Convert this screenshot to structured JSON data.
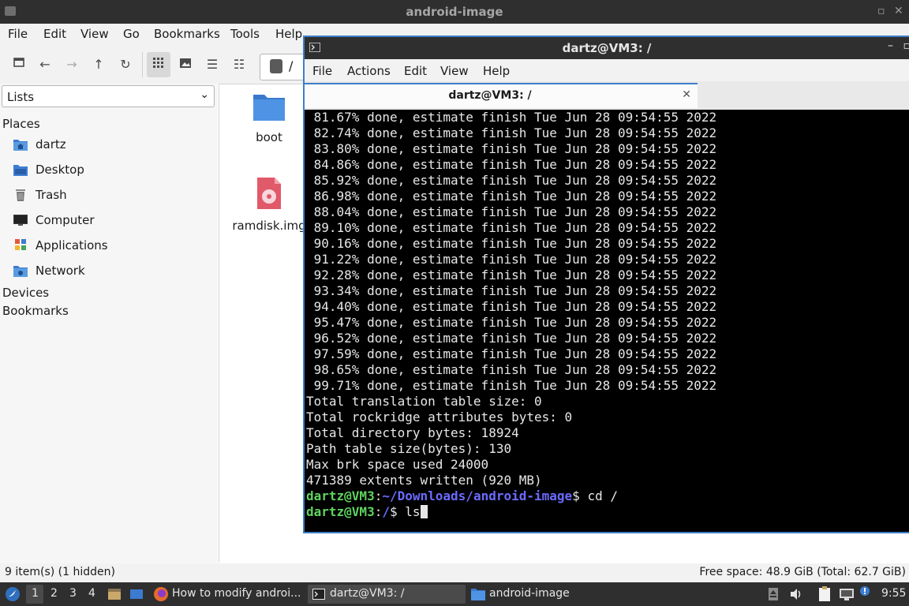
{
  "file_manager": {
    "title": "android-image",
    "menu": [
      "File",
      "Edit",
      "View",
      "Go",
      "Bookmarks",
      "Tools",
      "Help"
    ],
    "path_field": "/",
    "sidebar": {
      "selector": "Lists",
      "places_header": "Places",
      "places": [
        {
          "label": "dartz",
          "icon": "home-folder-icon"
        },
        {
          "label": "Desktop",
          "icon": "desktop-icon"
        },
        {
          "label": "Trash",
          "icon": "trash-icon"
        },
        {
          "label": "Computer",
          "icon": "computer-icon"
        },
        {
          "label": "Applications",
          "icon": "applications-icon"
        },
        {
          "label": "Network",
          "icon": "network-icon"
        }
      ],
      "devices_header": "Devices",
      "bookmarks_header": "Bookmarks"
    },
    "files": [
      {
        "name": "boot",
        "icon": "folder-icon"
      },
      {
        "name": "ramdisk.img",
        "icon": "disk-image-icon"
      }
    ],
    "status_left": "9 item(s) (1 hidden)",
    "status_right": "Free space: 48.9 GiB (Total: 62.7 GiB)"
  },
  "terminal": {
    "title": "dartz@VM3: /",
    "menu": [
      "File",
      "Actions",
      "Edit",
      "View",
      "Help"
    ],
    "tab_label": "dartz@VM3: /",
    "lines": [
      " 81.67% done, estimate finish Tue Jun 28 09:54:55 2022",
      " 82.74% done, estimate finish Tue Jun 28 09:54:55 2022",
      " 83.80% done, estimate finish Tue Jun 28 09:54:55 2022",
      " 84.86% done, estimate finish Tue Jun 28 09:54:55 2022",
      " 85.92% done, estimate finish Tue Jun 28 09:54:55 2022",
      " 86.98% done, estimate finish Tue Jun 28 09:54:55 2022",
      " 88.04% done, estimate finish Tue Jun 28 09:54:55 2022",
      " 89.10% done, estimate finish Tue Jun 28 09:54:55 2022",
      " 90.16% done, estimate finish Tue Jun 28 09:54:55 2022",
      " 91.22% done, estimate finish Tue Jun 28 09:54:55 2022",
      " 92.28% done, estimate finish Tue Jun 28 09:54:55 2022",
      " 93.34% done, estimate finish Tue Jun 28 09:54:55 2022",
      " 94.40% done, estimate finish Tue Jun 28 09:54:55 2022",
      " 95.47% done, estimate finish Tue Jun 28 09:54:55 2022",
      " 96.52% done, estimate finish Tue Jun 28 09:54:55 2022",
      " 97.59% done, estimate finish Tue Jun 28 09:54:55 2022",
      " 98.65% done, estimate finish Tue Jun 28 09:54:55 2022",
      " 99.71% done, estimate finish Tue Jun 28 09:54:55 2022",
      "Total translation table size: 0",
      "Total rockridge attributes bytes: 0",
      "Total directory bytes: 18924",
      "Path table size(bytes): 130",
      "Max brk space used 24000",
      "471389 extents written (920 MB)"
    ],
    "prompt_user": "dartz@VM3",
    "prompt1_path": "~/Downloads/android-image",
    "prompt1_cmd": " cd /",
    "prompt2_path": "/",
    "prompt2_cmd": " ls"
  },
  "taskbar": {
    "workspaces": [
      "1",
      "2",
      "3",
      "4"
    ],
    "tasks": [
      {
        "label": "How to modify androi...",
        "icon": "firefox-icon"
      },
      {
        "label": "dartz@VM3: /",
        "icon": "terminal-icon"
      },
      {
        "label": "android-image",
        "icon": "folder-icon"
      }
    ],
    "clock": "9:55"
  },
  "colors": {
    "prompt_green": "#5fd35f",
    "prompt_blue": "#6b6bff",
    "accent": "#3d7ec8"
  }
}
